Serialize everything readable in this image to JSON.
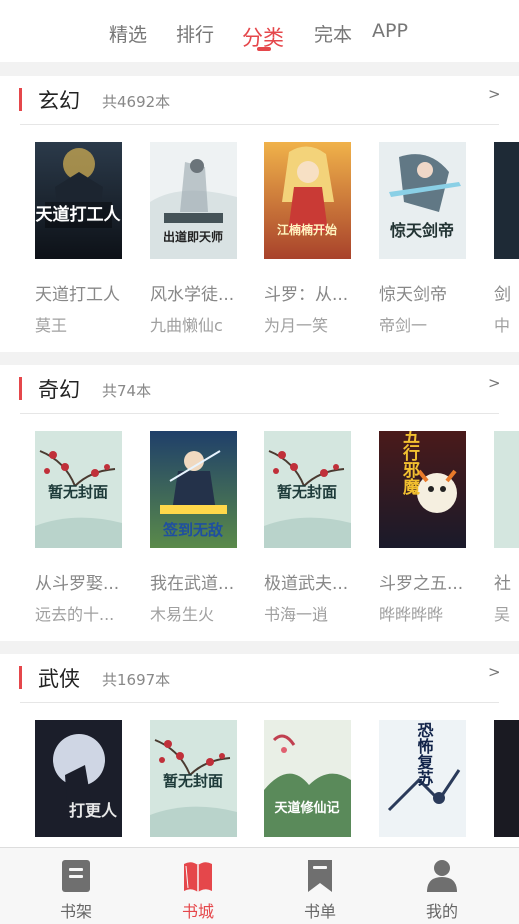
{
  "top_tabs": [
    {
      "label": "精选"
    },
    {
      "label": "排行"
    },
    {
      "label": "分类",
      "active": true
    },
    {
      "label": "完本"
    },
    {
      "label": "APP"
    }
  ],
  "sections": [
    {
      "title": "玄幻",
      "count": "共4692本",
      "more": ">",
      "books": [
        {
          "title": "天道打工人",
          "author": "莫王",
          "cover_text": "天道打工人"
        },
        {
          "title": "风水学徒...",
          "author": "九曲懒仙c",
          "cover_text": "出道即天师"
        },
        {
          "title": "斗罗：从...",
          "author": "为月一笑",
          "cover_text": "江楠楠开始"
        },
        {
          "title": "惊天剑帝",
          "author": "帝剑一",
          "cover_text": "惊天剑帝"
        },
        {
          "title": "剑",
          "author": "中"
        }
      ]
    },
    {
      "title": "奇幻",
      "count": "共74本",
      "more": ">",
      "books": [
        {
          "title": "从斗罗娶...",
          "author": "远去的十...",
          "cover_text": "暂无封面"
        },
        {
          "title": "我在武道...",
          "author": "木易生火",
          "cover_text": "签到无敌"
        },
        {
          "title": "极道武夫...",
          "author": "书海一逍",
          "cover_text": "暂无封面"
        },
        {
          "title": "斗罗之五...",
          "author": "晔晔晔晔",
          "cover_text": "五行邪魔"
        },
        {
          "title": "社",
          "author": "吴"
        }
      ]
    },
    {
      "title": "武侠",
      "count": "共1697本",
      "more": ">",
      "books": [
        {
          "title": "",
          "author": "",
          "cover_text": "打更人"
        },
        {
          "title": "",
          "author": "",
          "cover_text": "暂无封面"
        },
        {
          "title": "",
          "author": "",
          "cover_text": "天道修仙记"
        },
        {
          "title": "",
          "author": "",
          "cover_text": "恐怖复苏"
        },
        {
          "title": "",
          "author": ""
        }
      ]
    }
  ],
  "bottom_nav": [
    {
      "label": "书架",
      "icon": "bookshelf-icon"
    },
    {
      "label": "书城",
      "icon": "book-open-icon",
      "active": true
    },
    {
      "label": "书单",
      "icon": "bookmark-icon"
    },
    {
      "label": "我的",
      "icon": "user-icon"
    }
  ],
  "colors": {
    "accent": "#e5474b",
    "band": "#f2f2f2",
    "nav_bg": "#f7f7f7"
  }
}
